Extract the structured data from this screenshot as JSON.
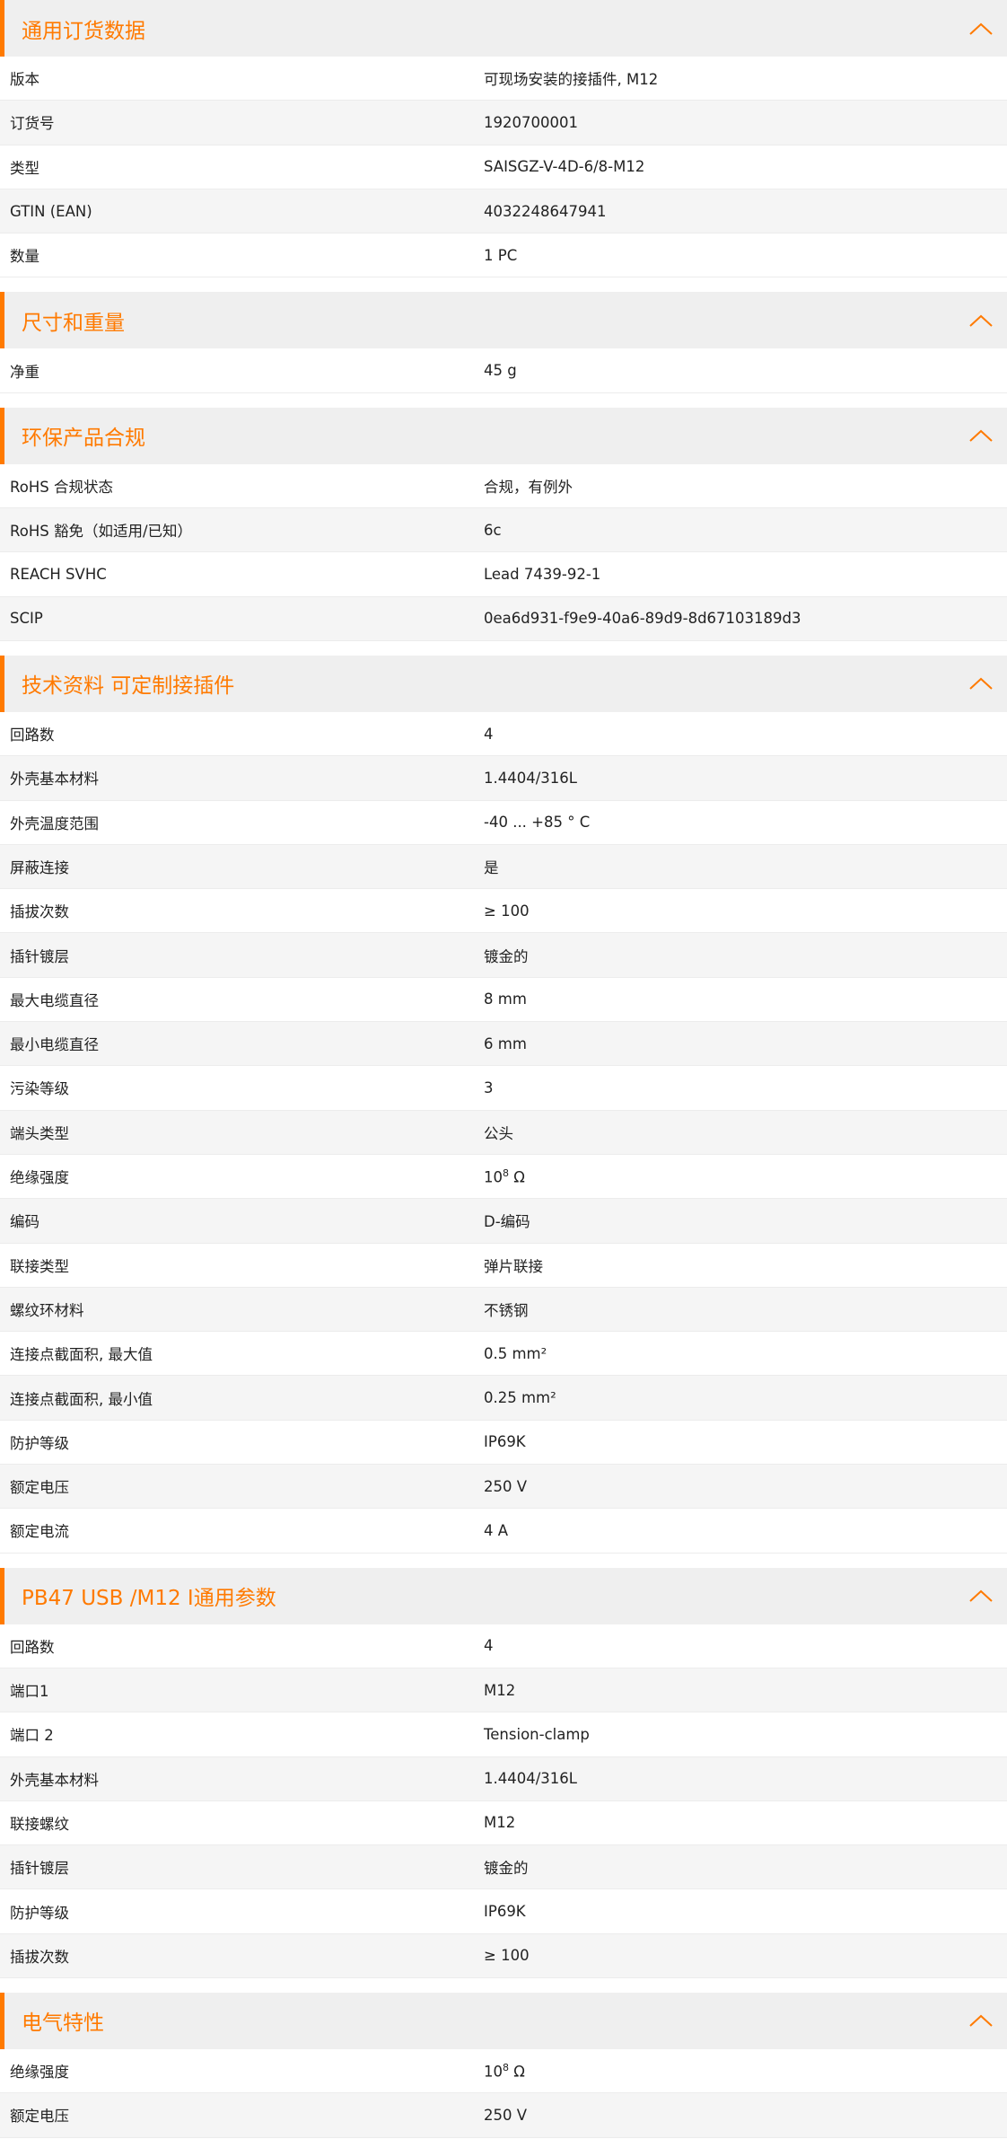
{
  "sections": [
    {
      "title": "通用订货数据",
      "rows": [
        {
          "k": "版本",
          "v": "可现场安装的接插件, M12"
        },
        {
          "k": "订货号",
          "v": "1920700001"
        },
        {
          "k": "类型",
          "v": "SAISGZ-V-4D-6/8-M12"
        },
        {
          "k": "GTIN (EAN)",
          "v": "4032248647941"
        },
        {
          "k": "数量",
          "v": "1  PC"
        }
      ]
    },
    {
      "title": "尺寸和重量",
      "rows": [
        {
          "k": "净重",
          "v": "45  g"
        }
      ]
    },
    {
      "title": "环保产品合规",
      "rows": [
        {
          "k": "RoHS 合规状态",
          "v": "合规，有例外"
        },
        {
          "k": "RoHS 豁免（如适用/已知）",
          "v": "6c"
        },
        {
          "k": "REACH SVHC",
          "v": "Lead 7439-92-1"
        },
        {
          "k": "SCIP",
          "v": "0ea6d931-f9e9-40a6-89d9-8d67103189d3"
        }
      ]
    },
    {
      "title": "技术资料 可定制接插件",
      "rows": [
        {
          "k": "回路数",
          "v": "4"
        },
        {
          "k": "外壳基本材料",
          "v": "1.4404/316L"
        },
        {
          "k": "外壳温度范围",
          "v": "-40 ... +85 ° C"
        },
        {
          "k": "屏蔽连接",
          "v": "是"
        },
        {
          "k": "插拔次数",
          "v": "≥ 100"
        },
        {
          "k": "插针镀层",
          "v": "镀金的"
        },
        {
          "k": "最大电缆直径",
          "v": "8  mm"
        },
        {
          "k": "最小电缆直径",
          "v": "6  mm"
        },
        {
          "k": "污染等级",
          "v": "3"
        },
        {
          "k": "端头类型",
          "v": "公头"
        },
        {
          "k": "绝缘强度",
          "v": "10",
          "sup": "8",
          "vtail": " Ω"
        },
        {
          "k": "编码",
          "v": "D-编码"
        },
        {
          "k": "联接类型",
          "v": "弹片联接"
        },
        {
          "k": "螺纹环材料",
          "v": "不锈钢"
        },
        {
          "k": "连接点截面积, 最大值",
          "v": "0.5  mm²"
        },
        {
          "k": "连接点截面积, 最小值",
          "v": "0.25  mm²"
        },
        {
          "k": "防护等级",
          "v": "IP69K"
        },
        {
          "k": "额定电压",
          "v": "250  V"
        },
        {
          "k": "额定电流",
          "v": "4  A"
        }
      ]
    },
    {
      "title": "PB47 USB /M12 I通用参数",
      "rows": [
        {
          "k": "回路数",
          "v": "4"
        },
        {
          "k": "端口1",
          "v": "M12"
        },
        {
          "k": "端口 2",
          "v": "Tension-clamp"
        },
        {
          "k": "外壳基本材料",
          "v": "1.4404/316L"
        },
        {
          "k": "联接螺纹",
          "v": "M12"
        },
        {
          "k": "插针镀层",
          "v": "镀金的"
        },
        {
          "k": "防护等级",
          "v": "IP69K"
        },
        {
          "k": "插拔次数",
          "v": "≥ 100"
        }
      ]
    },
    {
      "title": "电气特性",
      "rows": [
        {
          "k": "绝缘强度",
          "v": "10",
          "sup": "8",
          "vtail": " Ω"
        },
        {
          "k": "额定电压",
          "v": "250  V"
        }
      ]
    }
  ],
  "icons": {
    "collapse": "chevron-up-icon"
  },
  "colors": {
    "accent": "#ff7a00",
    "header_bg": "#efefef",
    "row_alt": "#f5f5f5"
  }
}
